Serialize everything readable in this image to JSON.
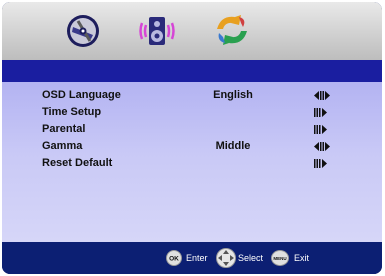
{
  "menu": {
    "items": [
      {
        "label": "OSD Language",
        "value": "English",
        "arrow": "left-right"
      },
      {
        "label": "Time Setup",
        "value": "",
        "arrow": "right"
      },
      {
        "label": "Parental",
        "value": "",
        "arrow": "right"
      },
      {
        "label": "Gamma",
        "value": "Middle",
        "arrow": "left-right"
      },
      {
        "label": "Reset Default",
        "value": "",
        "arrow": "right"
      }
    ]
  },
  "tabs": [
    {
      "icon": "disc-settings-icon"
    },
    {
      "icon": "speaker-audio-icon"
    },
    {
      "icon": "color-wheel-icon"
    }
  ],
  "footer": {
    "ok_label": "OK",
    "enter_label": "Enter",
    "select_label": "Select",
    "menu_label": "MENU",
    "exit_label": "Exit"
  },
  "colors": {
    "background": "#0c1f73",
    "panel": "#c4c4f4",
    "header_strip": "#1a1ea0"
  }
}
